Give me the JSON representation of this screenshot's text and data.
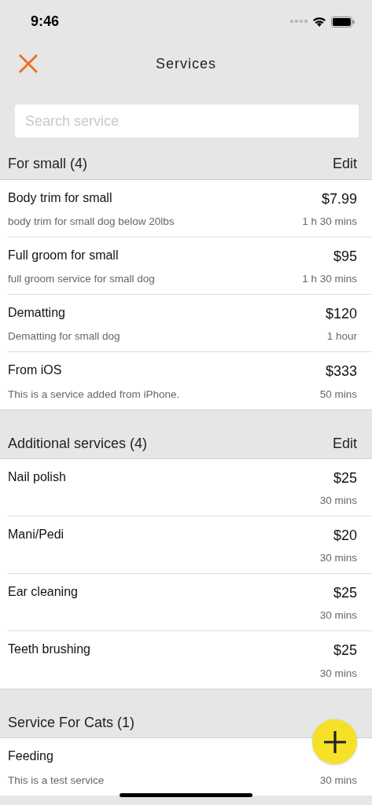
{
  "status_bar": {
    "time": "9:46"
  },
  "nav": {
    "title": "Services"
  },
  "search": {
    "placeholder": "Search service"
  },
  "sections": [
    {
      "title": "For small (4)",
      "action": "Edit",
      "items": [
        {
          "name": "Body trim for small",
          "description": "body trim for small dog below 20lbs",
          "price": "$7.99",
          "duration": "1 h 30 mins"
        },
        {
          "name": "Full groom for small",
          "description": "full groom service for small dog",
          "price": "$95",
          "duration": "1 h 30 mins"
        },
        {
          "name": "Dematting",
          "description": "Dematting for small dog",
          "price": "$120",
          "duration": "1 hour"
        },
        {
          "name": "From iOS",
          "description": "This is a service added from iPhone.",
          "price": "$333",
          "duration": "50 mins"
        }
      ]
    },
    {
      "title": "Additional services (4)",
      "action": "Edit",
      "items": [
        {
          "name": "Nail polish",
          "price": "$25",
          "duration": "30 mins"
        },
        {
          "name": "Mani/Pedi",
          "price": "$20",
          "duration": "30 mins"
        },
        {
          "name": "Ear cleaning",
          "price": "$25",
          "duration": "30 mins"
        },
        {
          "name": "Teeth brushing",
          "price": "$25",
          "duration": "30 mins"
        }
      ]
    },
    {
      "title": "Service For Cats (1)",
      "items": [
        {
          "name": "Feeding",
          "description": "This is a test service",
          "duration": "30 mins"
        }
      ]
    }
  ]
}
